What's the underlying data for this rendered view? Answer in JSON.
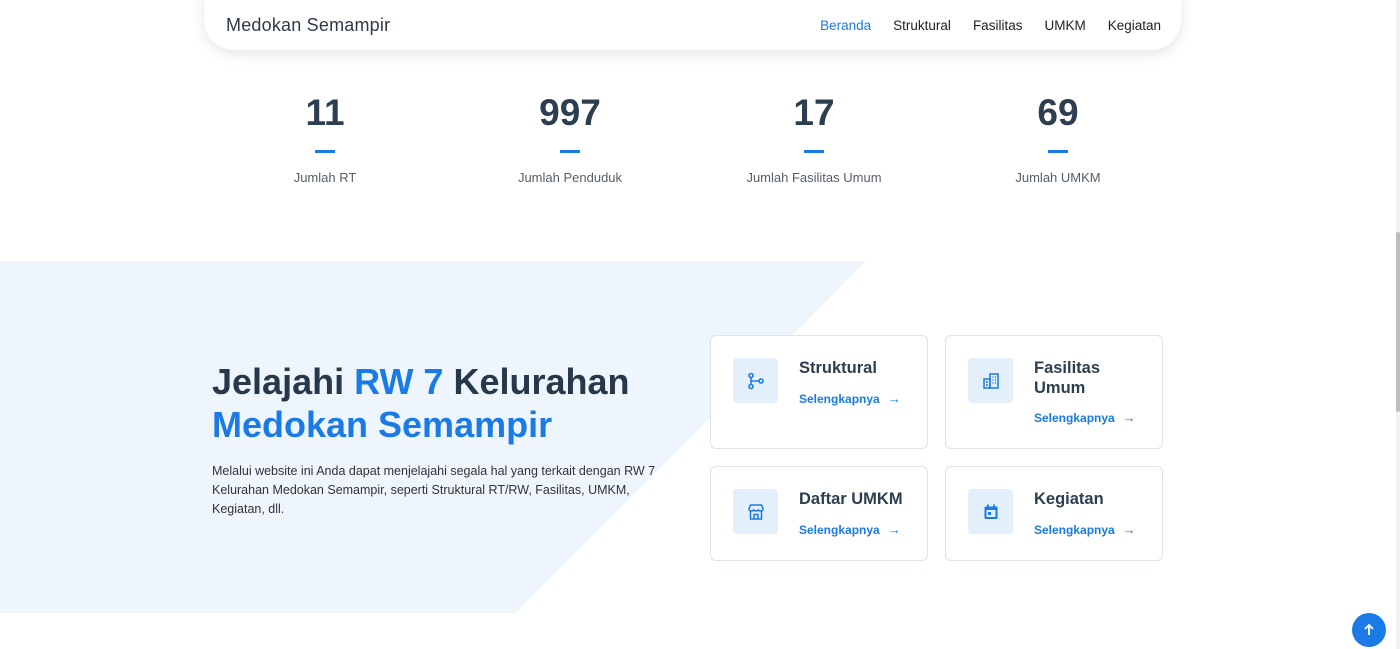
{
  "brand": "Medokan Semampir",
  "nav": [
    "Beranda",
    "Struktural",
    "Fasilitas",
    "UMKM",
    "Kegiatan"
  ],
  "stats": [
    {
      "value": "11",
      "label": "Jumlah RT"
    },
    {
      "value": "997",
      "label": "Jumlah Penduduk"
    },
    {
      "value": "17",
      "label": "Jumlah Fasilitas Umum"
    },
    {
      "value": "69",
      "label": "Jumlah UMKM"
    }
  ],
  "hero": {
    "title_a": "Jelajahi ",
    "title_b": "RW 7",
    "title_c": " Kelurahan",
    "title_d": "Medokan Semampir",
    "description": "Melalui website ini Anda dapat menjelajahi segala hal yang terkait dengan RW 7 Kelurahan Medokan Semampir, seperti Struktural RT/RW, Fasilitas, UMKM, Kegiatan, dll."
  },
  "cards": [
    {
      "title": "Struktural",
      "link": "Selengkapnya",
      "icon": "branch-icon"
    },
    {
      "title": "Fasilitas Umum",
      "link": "Selengkapnya",
      "icon": "building-icon"
    },
    {
      "title": "Daftar UMKM",
      "link": "Selengkapnya",
      "icon": "store-icon"
    },
    {
      "title": "Kegiatan",
      "link": "Selengkapnya",
      "icon": "calendar-icon"
    }
  ],
  "colors": {
    "accent": "#1a7be6",
    "heading": "#27384a",
    "section_bg": "#eef5fd"
  }
}
